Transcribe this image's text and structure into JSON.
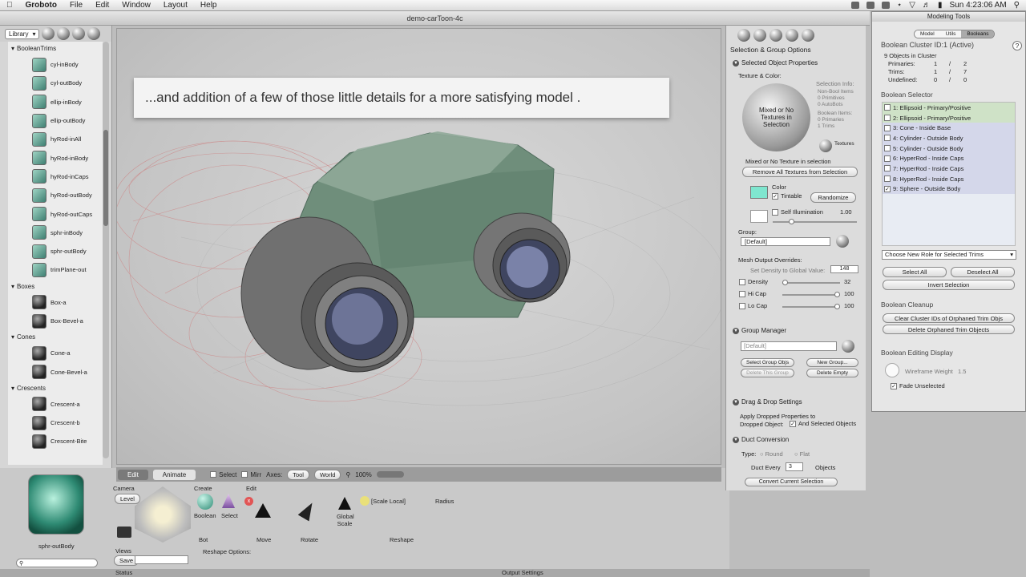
{
  "menubar": {
    "app": "Groboto",
    "items": [
      "File",
      "Edit",
      "Window",
      "Layout",
      "Help"
    ],
    "clock": "Sun 4:23:06 AM"
  },
  "document": {
    "title": "demo-carToon-4c"
  },
  "library": {
    "dropdown": "Library",
    "groups": [
      {
        "name": "BooleanTrims",
        "items": [
          "cyl-inBody",
          "cyl-outBody",
          "ellip-inBody",
          "ellip-outBody",
          "hyRod-inAll",
          "hyRod-inBody",
          "hyRod-inCaps",
          "hyRod-outBody",
          "hyRod-outCaps",
          "sphr-inBody",
          "sphr-outBody",
          "trimPlane-out"
        ]
      },
      {
        "name": "Boxes",
        "items": [
          "Box-a",
          "Box-Bevel-a"
        ]
      },
      {
        "name": "Cones",
        "items": [
          "Cone-a",
          "Cone-Bevel-a"
        ]
      },
      {
        "name": "Crescents",
        "items": [
          "Crescent-a",
          "Crescent-b",
          "Crescent-Bite"
        ]
      }
    ],
    "preview_label": "sphr-outBody"
  },
  "caption": "...and addition of a few of those little details for a more satisfying model .",
  "viewport_bar": {
    "tabs": [
      "Edit",
      "Animate"
    ],
    "select": "Select",
    "mirr": "Mirr",
    "axes": "Axes:",
    "tool": "Tool",
    "world": "World",
    "zoom": "100%"
  },
  "tools": {
    "camera": "Camera",
    "level": "Level",
    "create": "Create",
    "edit": "Edit",
    "boolean": "Boolean",
    "bot": "Bot",
    "select": "Select",
    "move": "Move",
    "rotate": "Rotate",
    "global_scale": "Global Scale",
    "scale_local": "[Scale Local]",
    "radius": "Radius",
    "reshape": "Reshape",
    "views": "Views",
    "save": "Save",
    "reshape_options": "Reshape Options:",
    "status": "Status",
    "output_settings": "Output Settings"
  },
  "props": {
    "header": "Selection & Group Options",
    "selected_props": "Selected Object Properties",
    "texture_color": "Texture & Color:",
    "texture_text": "Mixed or No Textures in Selection",
    "selection_info": "Selection Info:",
    "non_bool": "Non-Bool Items",
    "primitives": "0 Primitives",
    "autobots": "0 AutoBots",
    "bool_items": "Boolean Items:",
    "primaries": "0 Primaries",
    "trims": "1 Trims",
    "textures": "Textures",
    "mixed_note": "Mixed or No Texture in selection",
    "remove_all": "Remove All Textures from Selection",
    "color": "Color",
    "tintable": "Tintable",
    "randomize": "Randomize",
    "self_illum": "Self Illumination",
    "self_illum_val": "1.00",
    "group": "Group:",
    "group_value": "[Default]",
    "mesh_overrides": "Mesh Output Overrides:",
    "set_density": "Set Density to Global Value:",
    "density_global": "148",
    "density": "Density",
    "density_val": "32",
    "hicap": "Hi Cap",
    "hicap_val": "100",
    "locap": "Lo Cap",
    "locap_val": "100",
    "group_manager": "Group Manager",
    "gm_value": "[Default]",
    "select_group_objs": "Select Group Objs",
    "new_group": "New Group...",
    "delete_this_group": "Delete This Group",
    "delete_empty": "Delete Empty",
    "drag_drop": "Drag & Drop Settings",
    "apply_dropped": "Apply Dropped Properties to",
    "dropped_object": "Dropped Object:",
    "and_selected": "And Selected Objects",
    "duct": "Duct Conversion",
    "type": "Type:",
    "round": "Round",
    "flat": "Flat",
    "duct_every": "Duct Every",
    "duct_val": "3",
    "objects": "Objects",
    "convert": "Convert Current Selection"
  },
  "modeling_tools": {
    "title": "Modeling Tools",
    "tabs": [
      "Model",
      "Utils",
      "Booleans"
    ],
    "cluster": "Boolean Cluster ID:1 (Active)",
    "objects_in_cluster": "9 Objects in Cluster",
    "stats": [
      {
        "label": "Primaries:",
        "a": "1",
        "b": "2"
      },
      {
        "label": "Trims:",
        "a": "1",
        "b": "7"
      },
      {
        "label": "Undefined:",
        "a": "0",
        "b": "0"
      }
    ],
    "selector_title": "Boolean Selector",
    "selector": [
      {
        "text": "1: Ellipsoid - Primary/Positive",
        "kind": "g",
        "checked": false
      },
      {
        "text": "2: Ellipsoid - Primary/Positive",
        "kind": "g",
        "checked": false
      },
      {
        "text": "3: Cone - Inside Base",
        "kind": "b",
        "checked": false
      },
      {
        "text": "4: Cylinder - Outside Body",
        "kind": "b",
        "checked": false
      },
      {
        "text": "5: Cylinder - Outside Body",
        "kind": "b",
        "checked": false
      },
      {
        "text": "6: HyperRod - Inside Caps",
        "kind": "b",
        "checked": false
      },
      {
        "text": "7: HyperRod - Inside Caps",
        "kind": "b",
        "checked": false
      },
      {
        "text": "8: HyperRod - Inside Caps",
        "kind": "b",
        "checked": false
      },
      {
        "text": "9: Sphere - Outside Body",
        "kind": "b",
        "checked": true
      }
    ],
    "role_select": "Choose New Role for Selected Trims",
    "select_all": "Select All",
    "deselect_all": "Deselect All",
    "invert": "Invert Selection",
    "cleanup": "Boolean Cleanup",
    "clear_ids": "Clear Cluster IDs of Orphaned Trim Objs",
    "delete_orphaned": "Delete Orphaned Trim Objects",
    "editing_display": "Boolean Editing Display",
    "wire_weight": "Wireframe Weight",
    "wire_val": "1.5",
    "fade": "Fade Unselected"
  },
  "colors": {
    "car_body": "#6f8e7b",
    "swatch": "#7fe6cf",
    "primary_row": "#cfe2c7",
    "trim_row": "#d4d7ea"
  }
}
